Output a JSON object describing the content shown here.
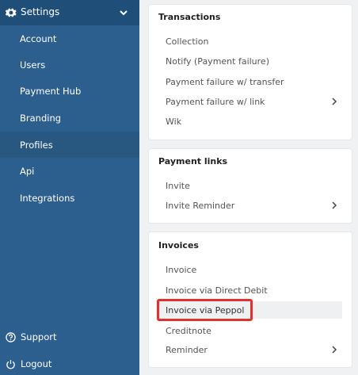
{
  "sidebar": {
    "header": "Settings",
    "items": [
      {
        "label": "Account"
      },
      {
        "label": "Users"
      },
      {
        "label": "Payment Hub"
      },
      {
        "label": "Branding"
      },
      {
        "label": "Profiles"
      },
      {
        "label": "Api"
      },
      {
        "label": "Integrations"
      }
    ],
    "bottom": [
      {
        "label": "Support"
      },
      {
        "label": "Logout"
      }
    ]
  },
  "cards": [
    {
      "title": "Transactions",
      "rows": [
        "Collection",
        "Notify (Payment failure)",
        "Payment failure w/ transfer",
        "Payment failure w/ link",
        "Wik"
      ]
    },
    {
      "title": "Payment links",
      "rows": [
        "Invite",
        "Invite Reminder"
      ]
    },
    {
      "title": "Invoices",
      "rows": [
        "Invoice",
        "Invoice via Direct Debit",
        "Invoice via Peppol",
        "Creditnote",
        "Reminder"
      ]
    }
  ],
  "colors": {
    "sidebar": "#2c5f8d",
    "sidebar_header": "#1f4e78",
    "highlight": "#e0312f"
  }
}
